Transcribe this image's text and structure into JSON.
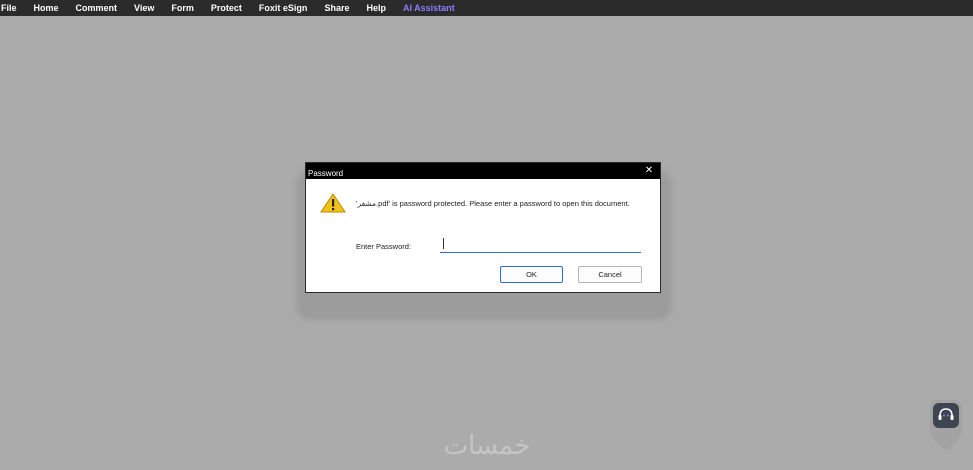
{
  "menubar": {
    "items": [
      "File",
      "Home",
      "Comment",
      "View",
      "Form",
      "Protect",
      "Foxit eSign",
      "Share",
      "Help"
    ],
    "ai_label": "AI Assistant",
    "ai_color": "#8c7cff"
  },
  "dialog": {
    "title": "Password",
    "message": "'مشفر.pdf' is password protected. Please enter a password to open this document.",
    "password_label": "Enter Password:",
    "password_value": "",
    "ok_label": "OK",
    "cancel_label": "Cancel",
    "icon": "warning-icon",
    "accent_color": "#2a6fd1"
  },
  "watermark": {
    "text": "خمسات"
  },
  "assistant": {
    "icon": "assistant-icon"
  }
}
